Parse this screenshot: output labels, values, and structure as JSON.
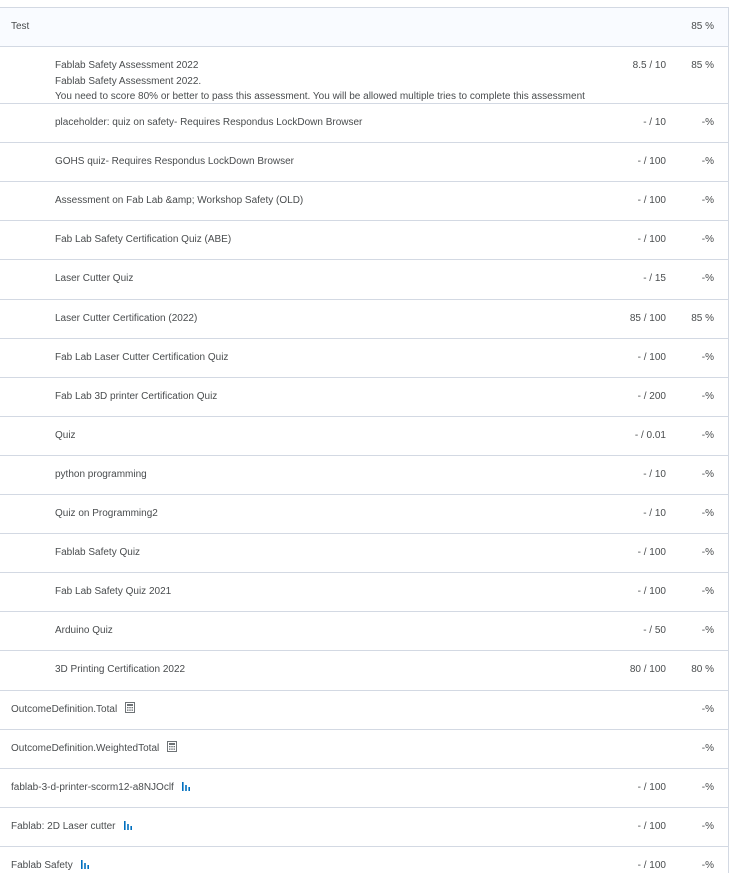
{
  "category": {
    "name": "Test",
    "percent": "85 %"
  },
  "items": [
    {
      "title": "Fablab Safety Assessment 2022",
      "subtitle": "Fablab Safety Assessment 2022.",
      "description": "You need to score 80% or better to pass this assessment.  You will be allowed multiple tries to complete this assessment",
      "points": "8.5 / 10",
      "percent": "85 %"
    },
    {
      "title": "placeholder: quiz on safety- Requires Respondus LockDown Browser",
      "points": "- / 10",
      "percent": "-%"
    },
    {
      "title": "GOHS quiz- Requires Respondus LockDown Browser",
      "points": "- / 100",
      "percent": "-%"
    },
    {
      "title": "Assessment on Fab Lab &amp; Workshop Safety (OLD)",
      "points": "- / 100",
      "percent": "-%"
    },
    {
      "title": "Fab Lab Safety Certification Quiz (ABE)",
      "points": "- / 100",
      "percent": "-%"
    },
    {
      "title": "Laser Cutter Quiz",
      "points": "- / 15",
      "percent": "-%"
    },
    {
      "title": "Laser Cutter Certification (2022)",
      "points": "85 / 100",
      "percent": "85 %"
    },
    {
      "title": "Fab Lab Laser Cutter Certification Quiz",
      "points": "- / 100",
      "percent": "-%"
    },
    {
      "title": "Fab Lab 3D printer Certification Quiz",
      "points": "- / 200",
      "percent": "-%"
    },
    {
      "title": "Quiz",
      "points": "- / 0.01",
      "percent": "-%"
    },
    {
      "title": "python programming",
      "points": "- / 10",
      "percent": "-%"
    },
    {
      "title": "Quiz on Programming2",
      "points": "- / 10",
      "percent": "-%"
    },
    {
      "title": "Fablab Safety Quiz",
      "points": "- / 100",
      "percent": "-%"
    },
    {
      "title": "Fab Lab Safety Quiz 2021",
      "points": "- / 100",
      "percent": "-%"
    },
    {
      "title": "Arduino Quiz",
      "points": "- / 50",
      "percent": "-%"
    },
    {
      "title": "3D Printing Certification 2022",
      "points": "80 / 100",
      "percent": "80 %"
    }
  ],
  "outcomes": [
    {
      "title": "OutcomeDefinition.Total",
      "icon": "calculator-icon",
      "points": "",
      "percent": "-%"
    },
    {
      "title": "OutcomeDefinition.WeightedTotal",
      "icon": "calculator-icon",
      "points": "",
      "percent": "-%"
    },
    {
      "title": "fablab-3-d-printer-scorm12-a8NJOclf",
      "icon": "statistics-icon",
      "points": "- / 100",
      "percent": "-%"
    },
    {
      "title": "Fablab: 2D Laser cutter",
      "icon": "statistics-icon",
      "points": "- / 100",
      "percent": "-%"
    },
    {
      "title": "Fablab Safety",
      "icon": "statistics-icon",
      "points": "- / 100",
      "percent": "-%"
    }
  ],
  "colors": {
    "text": "#494c4e",
    "border": "#d3d9e3",
    "category_bg": "#f9fbff",
    "icon_gray": "#6e7376",
    "icon_blue": "#006fbf"
  }
}
